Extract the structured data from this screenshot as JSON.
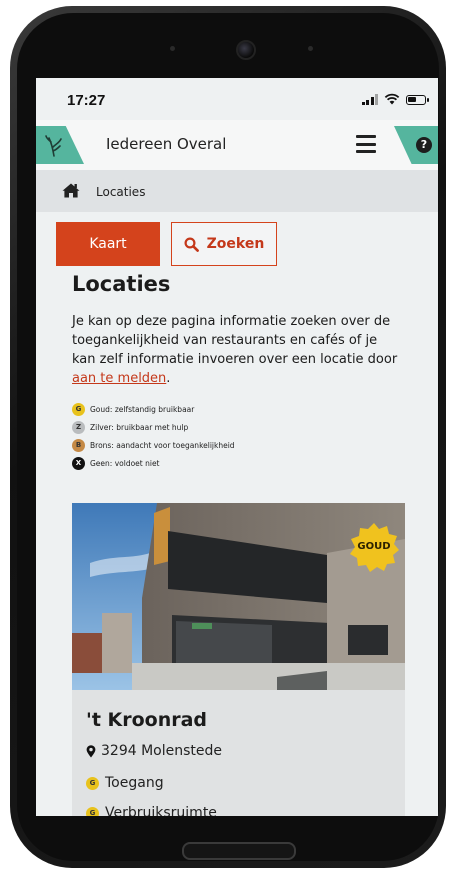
{
  "status": {
    "time": "17:27"
  },
  "header": {
    "brand": "Iedereen Overal",
    "logo_icon": "tree-leaf-icon",
    "menu_icon": "hamburger-icon",
    "help_icon": "question-icon",
    "help_glyph": "?"
  },
  "breadcrumb": {
    "icon": "home-icon",
    "label": "Locaties"
  },
  "buttons": {
    "map": "Kaart",
    "search": "Zoeken",
    "search_icon": "search-icon"
  },
  "page": {
    "title": "Locaties",
    "intro": "Je kan op deze pagina informatie zoeken over de toegankelijkheid van restaurants en cafés of je kan zelf informatie invoeren over een locatie door ",
    "intro_link": "aan te melden",
    "intro_end": "."
  },
  "legend": [
    {
      "letter": "G",
      "text": "Goud: zelfstandig bruikbaar"
    },
    {
      "letter": "Z",
      "text": "Zilver: bruikbaar met hulp"
    },
    {
      "letter": "B",
      "text": "Brons: aandacht voor toegankelijkheid"
    },
    {
      "letter": "X",
      "text": "Geen: voldoet niet"
    }
  ],
  "card": {
    "seal": "GOUD",
    "name": "'t Kroonrad",
    "location": "3294 Molenstede",
    "location_icon": "map-pin-icon",
    "access_badge": "G",
    "access": "Toegang",
    "usage": "Verbruiksruimte"
  },
  "colors": {
    "accent": "#d4431c",
    "teal": "#55b59e",
    "gold": "#e8c21c",
    "silver": "#b9bcbe",
    "bronze": "#c58a46"
  }
}
